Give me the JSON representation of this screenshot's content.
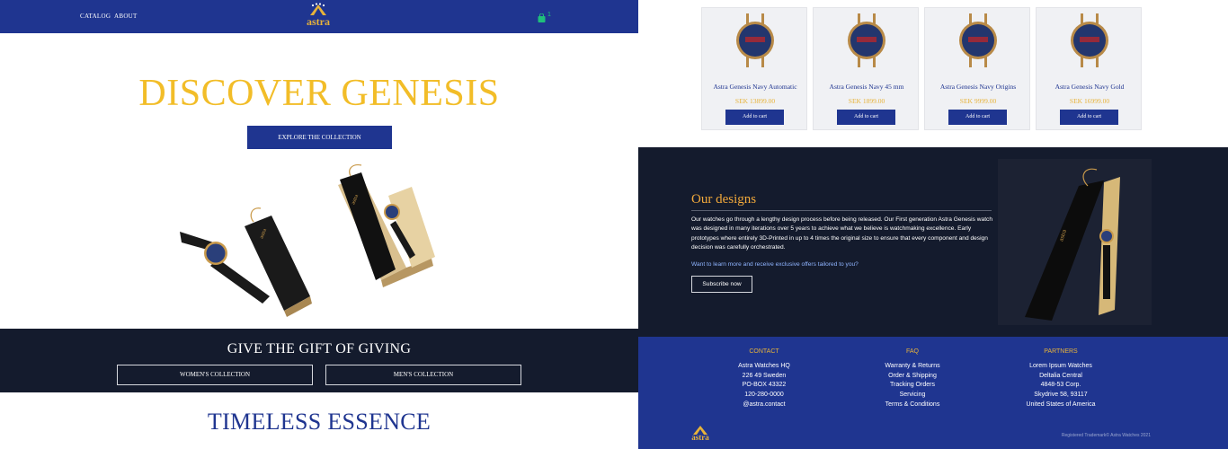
{
  "nav": {
    "catalog": "CATALOG",
    "about": "ABOUT",
    "logo_text": "astra",
    "cart_count": "1"
  },
  "hero": {
    "title": "DISCOVER GENESIS",
    "button": "EXPLORE THE COLLECTION"
  },
  "gift": {
    "title": "GIVE THE GIFT OF GIVING",
    "women": "WOMEN'S COLLECTION",
    "men": "MEN'S COLLECTION"
  },
  "timeless": {
    "title": "TIMELESS ESSENCE"
  },
  "products": [
    {
      "name": "Astra Genesis Navy Automatic",
      "price": "SEK 13899.00",
      "button": "Add to cart"
    },
    {
      "name": "Astra Genesis Navy 45 mm",
      "price": "SEK 1899.00",
      "button": "Add to cart"
    },
    {
      "name": "Astra Genesis Navy Origins",
      "price": "SEK 9999.00",
      "button": "Add to cart"
    },
    {
      "name": "Astra Genesis Navy Gold",
      "price": "SEK 16999.00",
      "button": "Add to cart"
    }
  ],
  "designs": {
    "title": "Our designs",
    "body": "Our watches go through a lengthy design process before being released. Our First generation Astra Genesis watch was designed in many iterations over 5 years to achieve what we believe is watchmaking excellence. Early prototypes where entirely 3D-Printed in up to 4 times the original size to ensure that every component and design decision was carefully orchestrated.",
    "cta": "Want to learn more and receive exclusive offers tailored to you?",
    "button": "Subscribe now"
  },
  "footer": {
    "contact": {
      "title": "CONTACT",
      "lines": [
        "Astra Watches HQ",
        "226 49 Sweden",
        "PO-BOX 43322",
        "120-280-0000",
        "@astra.contact"
      ]
    },
    "faq": {
      "title": "FAQ",
      "lines": [
        "Warranty & Returns",
        "Order & Shipping",
        "Tracking Orders",
        "Servicing",
        "Terms & Conditions"
      ]
    },
    "partners": {
      "title": "PARTNERS",
      "lines": [
        "Lorem Ipsum Watches",
        "Deltalia Central",
        "4848-53 Corp.",
        "Skydrive 58, 93117",
        "United States of America"
      ]
    },
    "logo_text": "astra",
    "copyright": "Registered Trademark© Astra Watches 2021"
  },
  "colors": {
    "navy": "#1f3590",
    "dark": "#141b2d",
    "gold": "#f2bd28",
    "accent": "#e7b33a"
  },
  "icons": {
    "cart": "shopping-bag-icon",
    "logo": "astra-logo-icon"
  }
}
